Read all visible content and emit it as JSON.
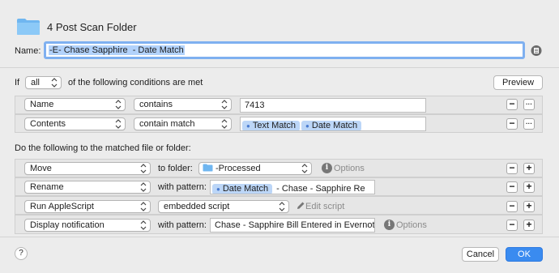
{
  "header": {
    "title": "4 Post Scan Folder",
    "name_label": "Name:",
    "name_value": "-E- Chase Sapphire  - Date Match"
  },
  "conditions": {
    "if_label": "If",
    "match_mode": "all",
    "suffix": "of the following conditions are met",
    "preview_label": "Preview",
    "rows": [
      {
        "attribute": "Name",
        "operator": "contains",
        "value": "7413",
        "tokens": []
      },
      {
        "attribute": "Contents",
        "operator": "contain match",
        "value": "",
        "tokens": [
          "Text Match",
          "Date Match"
        ]
      }
    ],
    "remove_symbol": "−",
    "more_symbol": "···"
  },
  "actions": {
    "heading": "Do the following to the matched file or folder:",
    "rows": [
      {
        "action": "Move",
        "connector": "to folder:",
        "target": "-Processed",
        "extra": "Options"
      },
      {
        "action": "Rename",
        "connector": "with pattern:",
        "token": "Date Match",
        "pattern_rest": " - Chase - Sapphire Re"
      },
      {
        "action": "Run AppleScript",
        "target": "embedded script",
        "extra": "Edit script"
      },
      {
        "action": "Display notification",
        "connector": "with pattern:",
        "pattern": "Chase - Sapphire Bill Entered in Evernote",
        "extra": "Options"
      }
    ],
    "remove_symbol": "−",
    "add_symbol": "+"
  },
  "footer": {
    "help_label": "?",
    "cancel_label": "Cancel",
    "ok_label": "OK"
  },
  "colors": {
    "accent": "#3a8bf0",
    "token_bg": "#bcd6f7",
    "folder": "#6fb6f0"
  }
}
